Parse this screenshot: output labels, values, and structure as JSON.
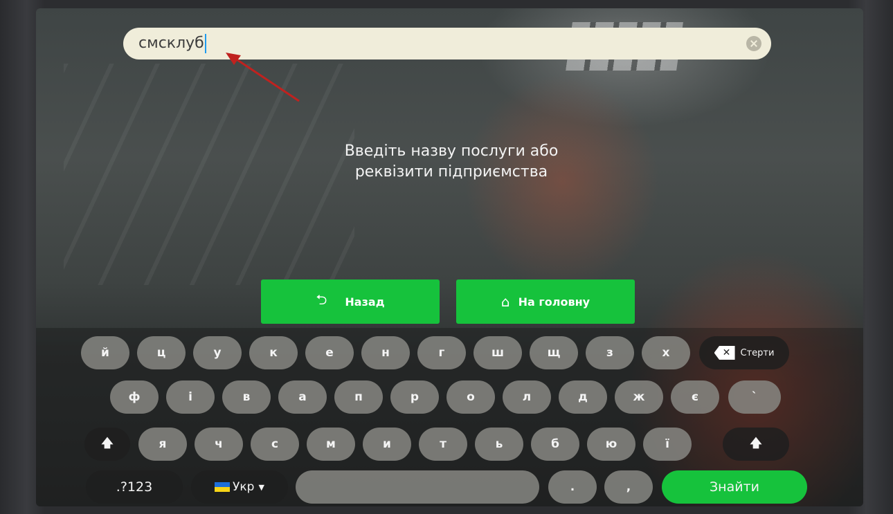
{
  "search": {
    "value": "смсклуб"
  },
  "prompt": {
    "line1": "Введіть назву послуги або",
    "line2": "реквізити підприємства"
  },
  "nav": {
    "back_label": "Назад",
    "home_label": "На головну",
    "back_icon": "undo-arrow-icon",
    "home_icon": "home-icon"
  },
  "keyboard": {
    "row1": [
      "й",
      "ц",
      "у",
      "к",
      "е",
      "н",
      "г",
      "ш",
      "щ",
      "з",
      "х"
    ],
    "row2": [
      "ф",
      "і",
      "в",
      "а",
      "п",
      "р",
      "о",
      "л",
      "д",
      "ж",
      "є",
      "`"
    ],
    "row3": [
      "я",
      "ч",
      "с",
      "м",
      "и",
      "т",
      "ь",
      "б",
      "ю",
      "ї"
    ],
    "backspace_label": "Стерти",
    "symbols_label": ".?123",
    "language_label": "Укр",
    "dot_label": ".",
    "comma_label": ",",
    "submit_label": "Знайти"
  },
  "colors": {
    "accent_green": "#16c23c",
    "search_bg": "#f0edda"
  }
}
